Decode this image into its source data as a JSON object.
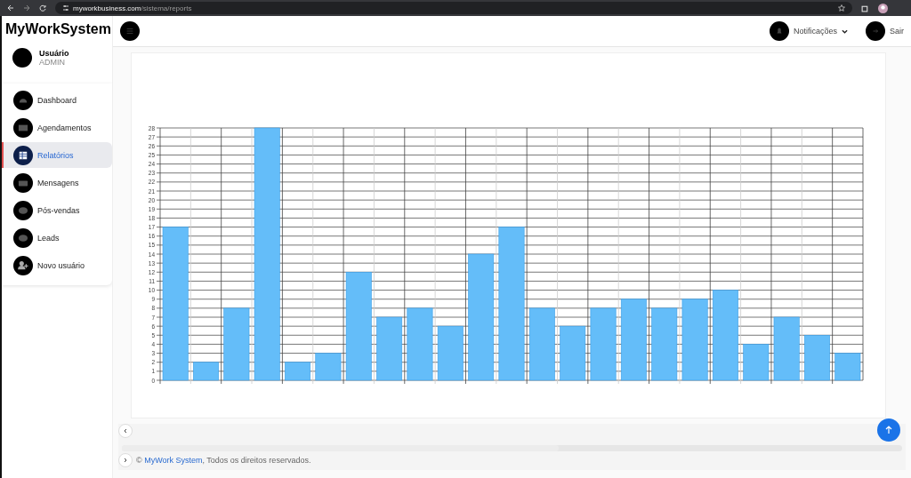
{
  "browser": {
    "url_host": "myworkbusiness.com",
    "url_path": "/sistema/reports"
  },
  "sidebar": {
    "brand": "MyWorkSystem",
    "user": {
      "name": "Usuário",
      "role": "ADMIN"
    },
    "items": [
      {
        "label": "Dashboard",
        "selected": false
      },
      {
        "label": "Agendamentos",
        "selected": false
      },
      {
        "label": "Relatórios",
        "selected": true
      },
      {
        "label": "Mensagens",
        "selected": false
      },
      {
        "label": "Pós-vendas",
        "selected": false
      },
      {
        "label": "Leads",
        "selected": false
      },
      {
        "label": "Novo usuário",
        "selected": false
      }
    ]
  },
  "header": {
    "notifications": "Notificações",
    "logout": "Sair"
  },
  "chart_data": {
    "type": "bar",
    "grid": true,
    "values": [
      17,
      2,
      8,
      28,
      2,
      3,
      12,
      7,
      8,
      6,
      14,
      17,
      8,
      6,
      8,
      9,
      8,
      9,
      10,
      4,
      7,
      5,
      3
    ],
    "ylim": [
      0,
      28
    ],
    "yticks": [
      0,
      1,
      2,
      3,
      4,
      5,
      6,
      7,
      8,
      9,
      10,
      11,
      12,
      13,
      14,
      15,
      16,
      17,
      18,
      19,
      20,
      21,
      22,
      23,
      24,
      25,
      26,
      27,
      28
    ]
  },
  "footer": {
    "prefix": "©",
    "link": "MyWork System",
    "text": ", Todos os direitos reservados."
  }
}
